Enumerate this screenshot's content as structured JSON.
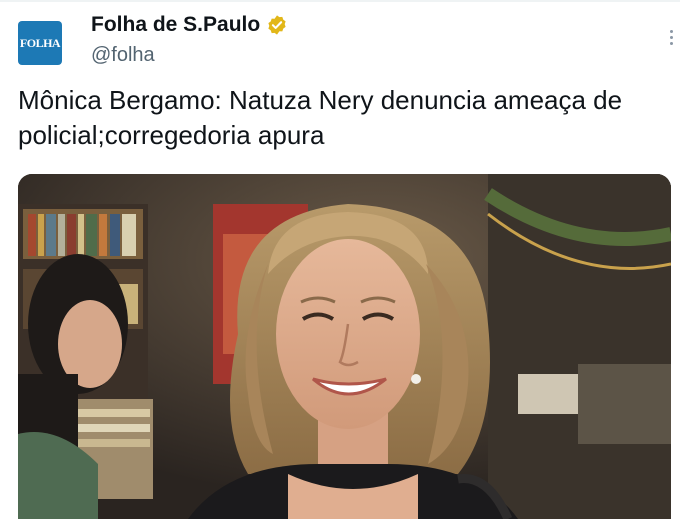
{
  "account": {
    "display_name": "Folha de S.Paulo",
    "handle": "@folha",
    "avatar_text": "FOLHA",
    "verified": true,
    "verified_color": "#e2b719"
  },
  "tweet": {
    "text": "Mônica Bergamo: Natuza Nery denuncia ameaça de policial;corregedoria apura"
  },
  "media": {
    "type": "photo",
    "icon": "photo-of-smiling-woman"
  },
  "icons": {
    "more": "more-options-icon",
    "verified": "verified-badge-icon"
  },
  "colors": {
    "avatar_bg": "#1d79b5",
    "handle": "#536471",
    "text": "#0f1419"
  }
}
